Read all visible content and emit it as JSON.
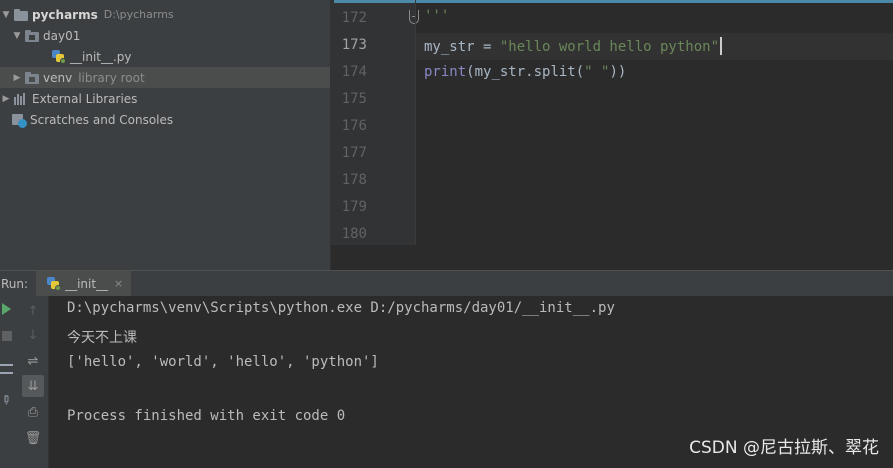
{
  "project_tree": {
    "root": {
      "name": "pycharms",
      "path": "D:\\pycharms"
    },
    "day01": {
      "name": "day01"
    },
    "init_file": {
      "name": "__init__.py"
    },
    "venv": {
      "name": "venv",
      "note": "library root"
    },
    "external": {
      "name": "External Libraries"
    },
    "scratches": {
      "name": "Scratches and Consoles"
    }
  },
  "editor": {
    "line_numbers": [
      "172",
      "173",
      "174",
      "175",
      "176",
      "177",
      "178",
      "179",
      "180"
    ],
    "active_line_number": "173",
    "code": {
      "line172": "'''",
      "line173": {
        "var": "my_str = ",
        "str": "\"hello world hello python\""
      },
      "line174": {
        "fn": "print",
        "rest_a": "(my_str.split(",
        "str": "\" \"",
        "rest_b": "))"
      }
    }
  },
  "run_panel": {
    "label": "Run:",
    "tab_name": "__init__",
    "tab_close": "×",
    "console": [
      "D:\\pycharms\\venv\\Scripts\\python.exe D:/pycharms/day01/__init__.py",
      "今天不上课",
      "['hello', 'world', 'hello', 'python']",
      "",
      "Process finished with exit code 0"
    ]
  },
  "watermark": "CSDN @尼古拉斯、翠花",
  "colors": {
    "accent": "#4e92b5",
    "string": "#6a8759",
    "builtin": "#8888c6",
    "run_green": "#59a869"
  }
}
